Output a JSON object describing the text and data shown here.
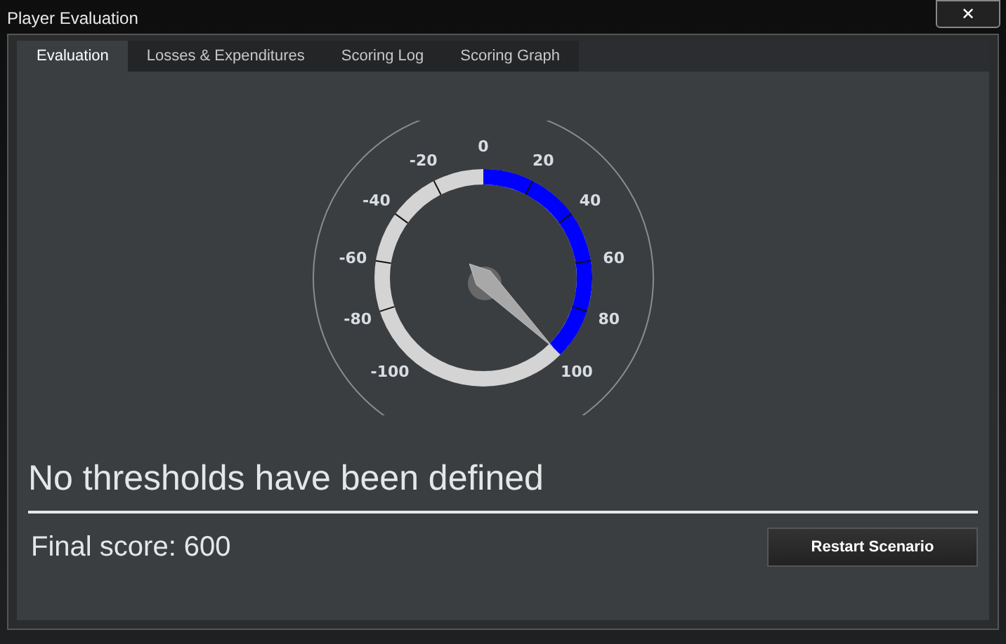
{
  "window": {
    "title": "Player Evaluation",
    "close": "✕"
  },
  "tabs": [
    {
      "label": "Evaluation",
      "selected": true
    },
    {
      "label": "Losses & Expenditures",
      "selected": false
    },
    {
      "label": "Scoring Log",
      "selected": false
    },
    {
      "label": "Scoring Graph",
      "selected": false
    }
  ],
  "gauge": {
    "ticks": [
      "-100",
      "-80",
      "-60",
      "-40",
      "-20",
      "0",
      "20",
      "40",
      "60",
      "80",
      "100"
    ]
  },
  "message": "No thresholds have been defined",
  "final_score": "Final score: 600",
  "button": "Restart Scenario"
}
